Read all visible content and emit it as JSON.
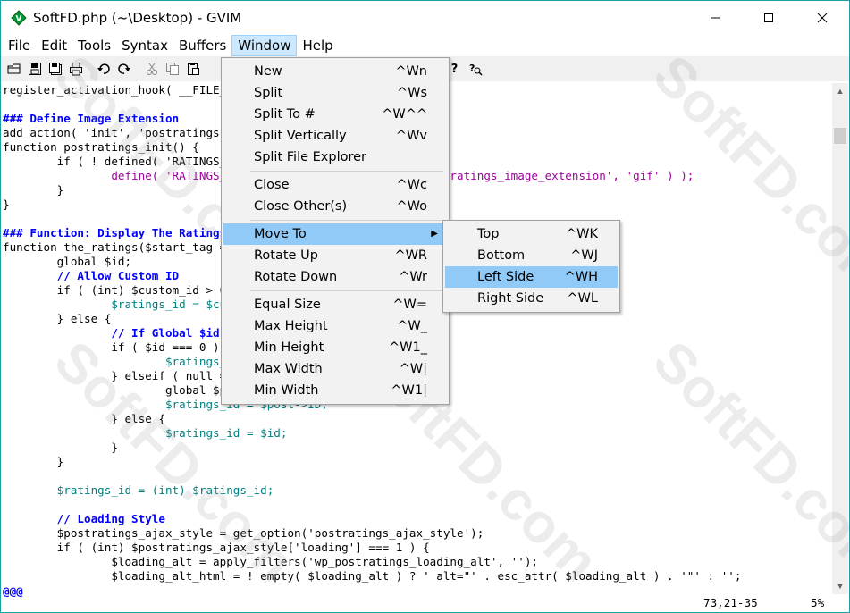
{
  "window": {
    "title": "SoftFD.php (~\\Desktop) - GVIM",
    "app_icon": "vim-icon",
    "controls": [
      "minimize-icon",
      "maximize-icon",
      "close-icon"
    ]
  },
  "menubar": {
    "items": [
      "File",
      "Edit",
      "Tools",
      "Syntax",
      "Buffers",
      "Window",
      "Help"
    ],
    "active": "Window"
  },
  "toolbar": {
    "icons": [
      "open-icon",
      "save-icon",
      "save-all-icon",
      "print-icon",
      "undo-icon",
      "redo-icon",
      "cut-icon",
      "copy-icon",
      "paste-icon",
      "help-icon",
      "find-help-icon"
    ]
  },
  "editor": {
    "lines": [
      "register_activation_hook( __FILE__, 'ratings_activation' );",
      "",
      "### Define Image Extension",
      "add_action( 'init', 'postratings_init' );",
      "function postratings_init() {",
      "        if ( ! defined( 'RATINGS_IMG_EXT' ) ) {",
      "                define( 'RATINGS_IMG_EXT', apply_filters( 'wp_postratings_image_extension', 'gif' ) );",
      "        }",
      "}",
      "",
      "### Function: Display The Ratings",
      "function the_ratings($start_tag = 'div', $custom_id = 0, $display = true) {",
      "        global $id;",
      "        // Allow Custom ID",
      "        if ( (int) $custom_id > 0 ) {",
      "                $ratings_id = $custom_id;",
      "        } else {",
      "                // If Global $id is 0, Get The Loop Post ID",
      "                if ( $id === 0 ) {",
      "                        $ratings_id = get_the_ID();",
      "                } elseif ( null === $id ) {",
      "                        global $post;",
      "                        $ratings_id = $post->ID;",
      "                } else {",
      "                        $ratings_id = $id;",
      "                }",
      "        }",
      "",
      "        $ratings_id = (int) $ratings_id;",
      "",
      "        // Loading Style",
      "        $postratings_ajax_style = get_option('postratings_ajax_style');",
      "        if ( (int) $postratings_ajax_style['loading'] === 1 ) {",
      "                $loading_alt = apply_filters('wp_postratings_loading_alt', '');",
      "                $loading_alt_html = ! empty( $loading_alt ) ? ' alt=\"' . esc_attr( $loading_alt ) . '\"' : '';"
    ],
    "tilde_line": "@@@"
  },
  "status": {
    "position": "73,21-35",
    "percent": "5%"
  },
  "window_menu": {
    "items": [
      {
        "label": "New",
        "accel": "^Wn"
      },
      {
        "label": "Split",
        "accel": "^Ws"
      },
      {
        "label": "Split To #",
        "accel": "^W^^"
      },
      {
        "label": "Split Vertically",
        "accel": "^Wv"
      },
      {
        "label": "Split File Explorer",
        "accel": ""
      },
      {
        "sep": true
      },
      {
        "label": "Close",
        "accel": "^Wc"
      },
      {
        "label": "Close Other(s)",
        "accel": "^Wo"
      },
      {
        "sep": true
      },
      {
        "label": "Move To",
        "accel": "",
        "submenu": true,
        "highlighted": true
      },
      {
        "label": "Rotate Up",
        "accel": "^WR"
      },
      {
        "label": "Rotate Down",
        "accel": "^Wr"
      },
      {
        "sep": true
      },
      {
        "label": "Equal Size",
        "accel": "^W="
      },
      {
        "label": "Max Height",
        "accel": "^W_"
      },
      {
        "label": "Min Height",
        "accel": "^W1_"
      },
      {
        "label": "Max Width",
        "accel": "^W|"
      },
      {
        "label": "Min Width",
        "accel": "^W1|"
      }
    ]
  },
  "moveto_menu": {
    "items": [
      {
        "label": "Top",
        "accel": "^WK"
      },
      {
        "label": "Bottom",
        "accel": "^WJ"
      },
      {
        "label": "Left Side",
        "accel": "^WH",
        "highlighted": true
      },
      {
        "label": "Right Side",
        "accel": "^WL"
      }
    ]
  },
  "watermark": "SoftFD.com"
}
